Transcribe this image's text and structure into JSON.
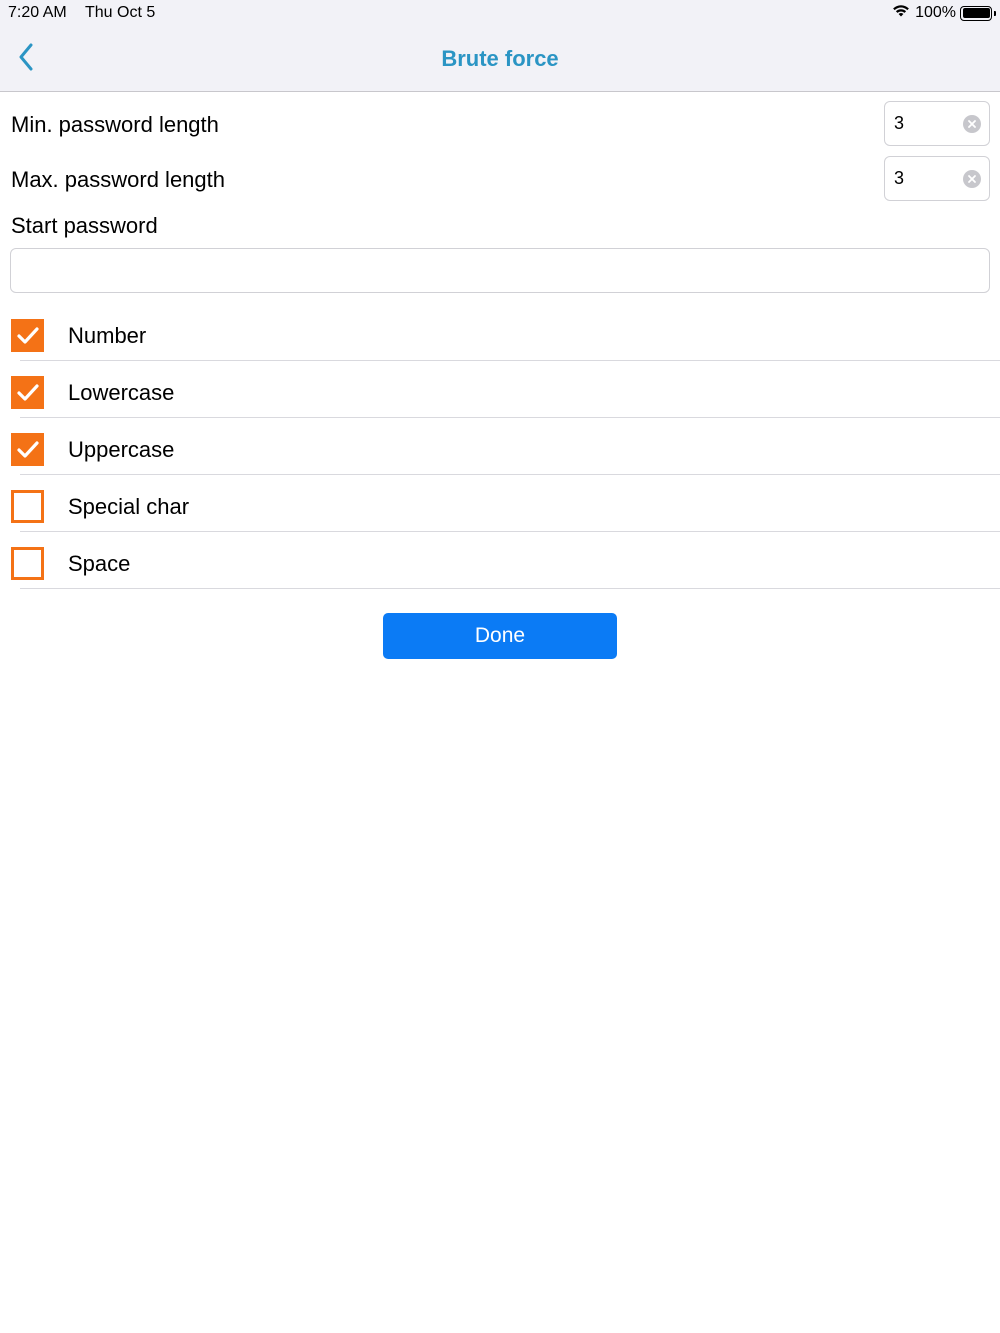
{
  "status_bar": {
    "time": "7:20 AM",
    "date": "Thu Oct 5",
    "battery": "100%"
  },
  "nav": {
    "title": "Brute force",
    "back_icon": "chevron-left-icon"
  },
  "form": {
    "min_length_label": "Min. password length",
    "min_length_value": "3",
    "max_length_label": "Max. password length",
    "max_length_value": "3",
    "start_password_label": "Start password",
    "start_password_value": ""
  },
  "options": [
    {
      "label": "Number",
      "checked": true
    },
    {
      "label": "Lowercase",
      "checked": true
    },
    {
      "label": "Uppercase",
      "checked": true
    },
    {
      "label": "Special char",
      "checked": false
    },
    {
      "label": "Space",
      "checked": false
    }
  ],
  "done_label": "Done",
  "colors": {
    "accent": "#2b95c4",
    "checkbox": "#f47216",
    "button": "#0b7bf5"
  }
}
